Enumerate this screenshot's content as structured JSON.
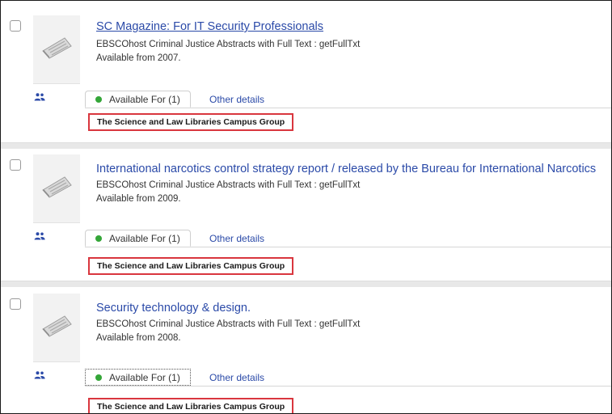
{
  "records": [
    {
      "title": "SC Magazine: For IT Security Professionals",
      "source": "EBSCOhost Criminal Justice Abstracts with Full Text : getFullTxt",
      "availability": "Available from 2007.",
      "tab_available": "Available For (1)",
      "tab_other": "Other details",
      "group": "The Science and Law Libraries Campus Group"
    },
    {
      "title": "International narcotics control strategy report / released by the Bureau for International Narcotics",
      "source": "EBSCOhost Criminal Justice Abstracts with Full Text : getFullTxt",
      "availability": "Available from 2009.",
      "tab_available": "Available For (1)",
      "tab_other": "Other details",
      "group": "The Science and Law Libraries Campus Group"
    },
    {
      "title": "Security technology & design.",
      "source": "EBSCOhost Criminal Justice Abstracts with Full Text : getFullTxt",
      "availability": "Available from 2008.",
      "tab_available": "Available For (1)",
      "tab_other": "Other details",
      "group": "The Science and Law Libraries Campus Group"
    }
  ],
  "icons": {
    "thumbnail": "newspaper-icon",
    "users": "users-icon",
    "status": "green-dot-icon"
  },
  "colors": {
    "link": "#2b4aa8",
    "status_available": "#34a638",
    "highlight_box": "#d9363e",
    "separator": "#e8e8e8"
  }
}
